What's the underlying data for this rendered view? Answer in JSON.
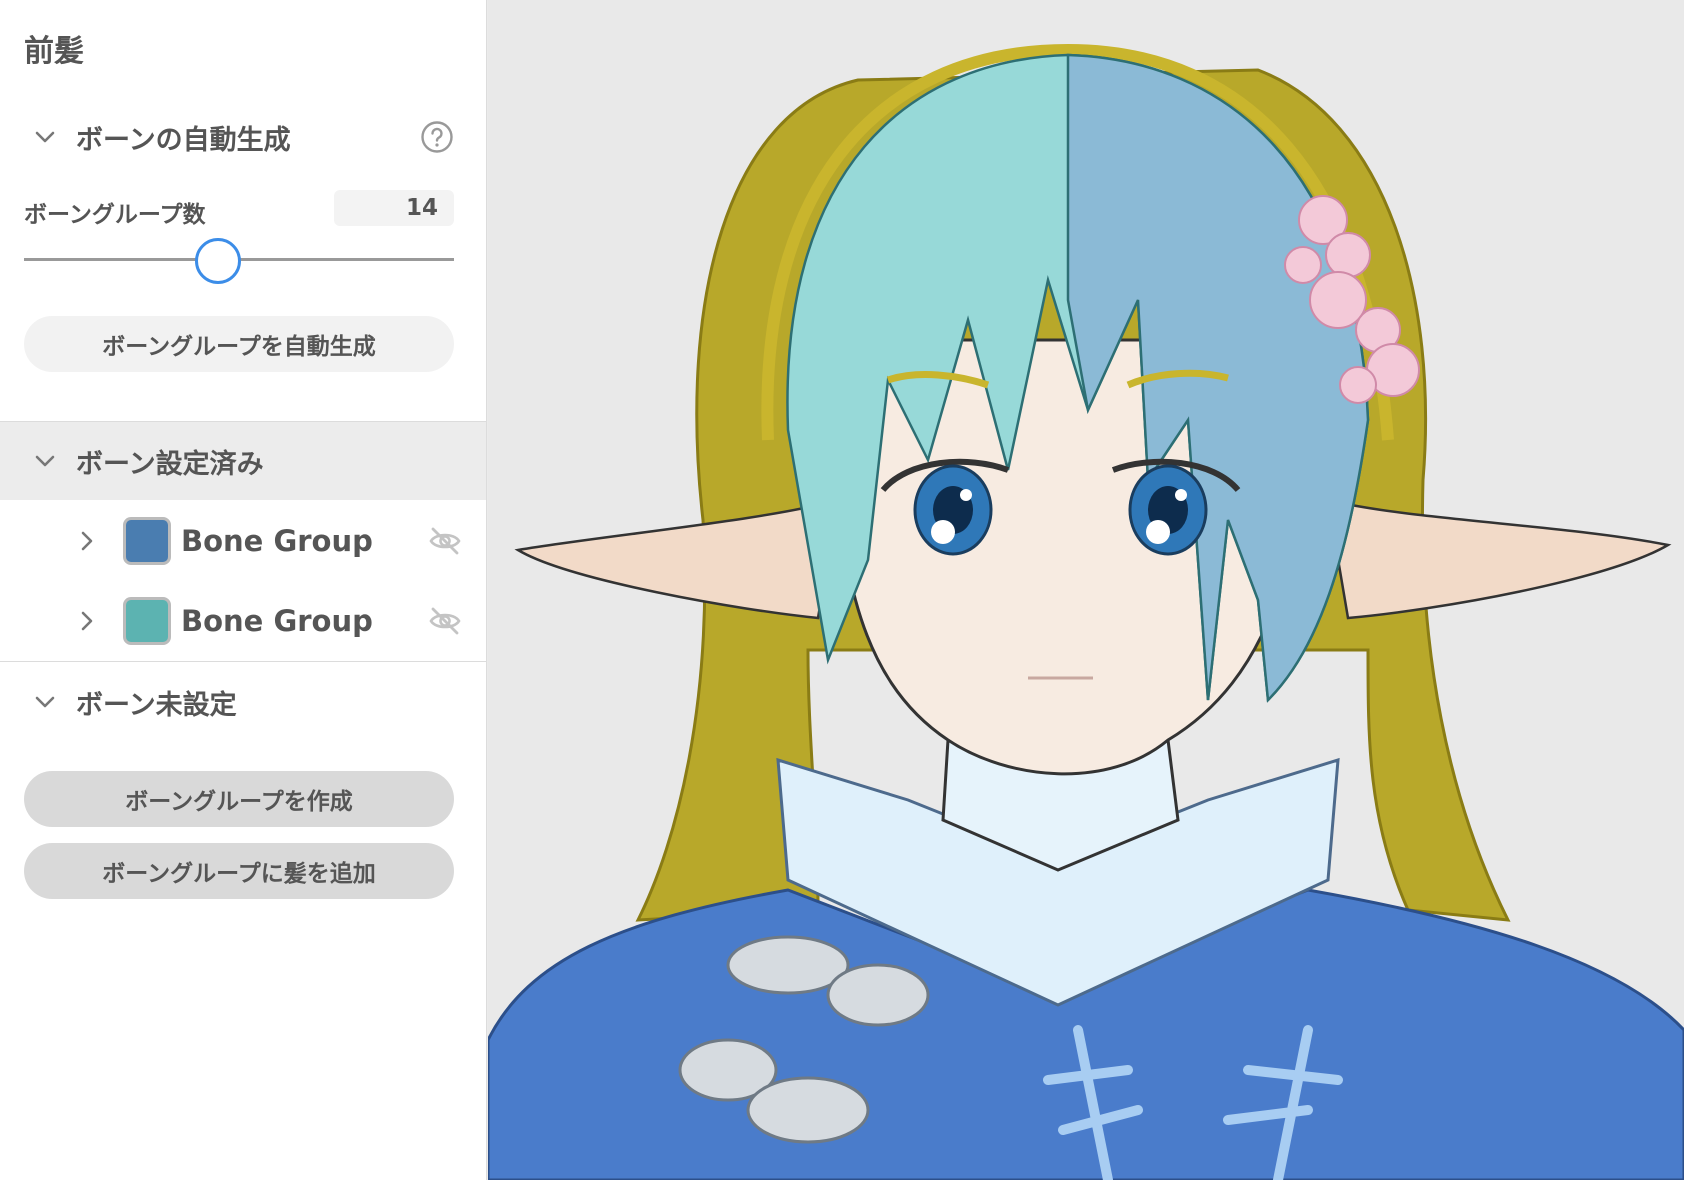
{
  "panel": {
    "title": "前髪",
    "auto_section": {
      "label": "ボーンの自動生成",
      "count_label": "ボーングループ数",
      "count_value": "14",
      "slider_fraction": 0.45,
      "auto_button": "ボーングループを自動生成"
    },
    "configured_section": {
      "label": "ボーン設定済み",
      "groups": [
        {
          "name": "Bone Group",
          "color": "#4a7db0",
          "visible": false
        },
        {
          "name": "Bone Group",
          "color": "#5cb3b1",
          "visible": false
        }
      ]
    },
    "unconfigured_section": {
      "label": "ボーン未設定",
      "create_button": "ボーングループを作成",
      "add_button": "ボーングループに髪を追加"
    }
  },
  "colors": {
    "accent": "#3c8de8",
    "hair_front": "#97d9d8",
    "hair_back": "#b8a82a",
    "outfit": "#4a7ccb"
  },
  "icons": {
    "collapse": "chevron-down-icon",
    "expand": "chevron-right-icon",
    "help": "question-circle-icon",
    "hidden": "eye-slash-icon"
  }
}
